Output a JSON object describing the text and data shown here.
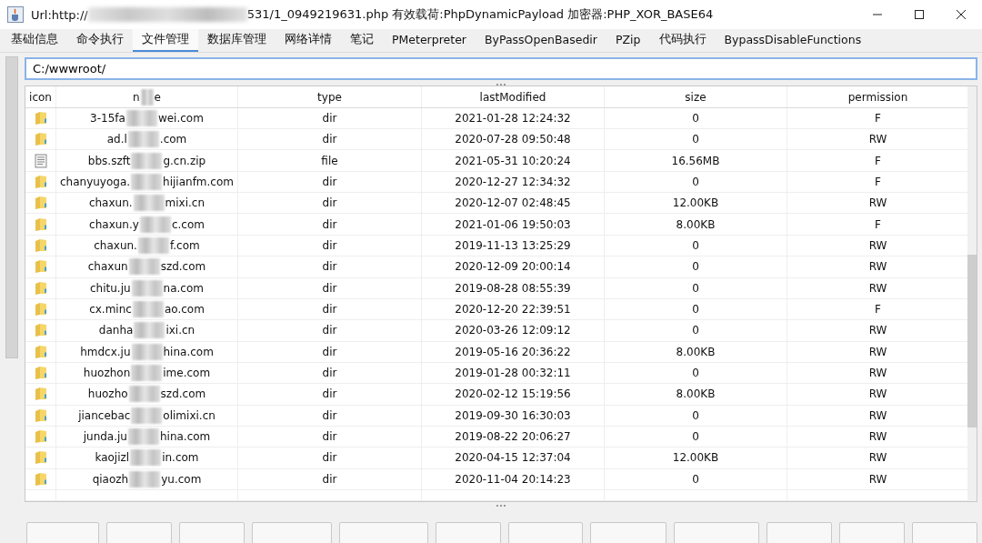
{
  "window": {
    "title_start": "Url:http://",
    "title_end": "531/1_0949219631.php 有效载荷:PhpDynamicPayload 加密器:PHP_XOR_BASE64"
  },
  "tabs": [
    {
      "label": "基础信息",
      "selected": false
    },
    {
      "label": "命令执行",
      "selected": false
    },
    {
      "label": "文件管理",
      "selected": true
    },
    {
      "label": "数据库管理",
      "selected": false
    },
    {
      "label": "网络详情",
      "selected": false
    },
    {
      "label": "笔记",
      "selected": false
    },
    {
      "label": "PMeterpreter",
      "selected": false
    },
    {
      "label": "ByPassOpenBasedir",
      "selected": false
    },
    {
      "label": "PZip",
      "selected": false
    },
    {
      "label": "代码执行",
      "selected": false
    },
    {
      "label": "BypassDisableFunctions",
      "selected": false
    }
  ],
  "path_field": {
    "value": "C:/wwwroot/"
  },
  "table": {
    "columns": [
      {
        "label": "icon"
      },
      {
        "label_start": "n",
        "label_end": "e"
      },
      {
        "label": "type"
      },
      {
        "label": "lastModified"
      },
      {
        "label": "size"
      },
      {
        "label": "permission"
      }
    ],
    "rows": [
      {
        "kind": "folder",
        "name_start": "3-15fa",
        "name_end": "wei.com",
        "type": "dir",
        "modified": "2021-01-28 12:24:32",
        "size": "0",
        "permission": "F"
      },
      {
        "kind": "folder",
        "name_start": "ad.l",
        "name_end": ".com",
        "type": "dir",
        "modified": "2020-07-28 09:50:48",
        "size": "0",
        "permission": "RW"
      },
      {
        "kind": "file",
        "name_start": "bbs.szft",
        "name_end": "g.cn.zip",
        "type": "file",
        "modified": "2021-05-31 10:20:24",
        "size": "16.56MB",
        "permission": "F"
      },
      {
        "kind": "folder",
        "name_start": "chanyuyoga.",
        "name_end": "hijianfm.com",
        "type": "dir",
        "modified": "2020-12-27 12:34:32",
        "size": "0",
        "permission": "F"
      },
      {
        "kind": "folder",
        "name_start": "chaxun.",
        "name_end": "mixi.cn",
        "type": "dir",
        "modified": "2020-12-07 02:48:45",
        "size": "12.00KB",
        "permission": "RW"
      },
      {
        "kind": "folder",
        "name_start": "chaxun.y",
        "name_end": "c.com",
        "type": "dir",
        "modified": "2021-01-06 19:50:03",
        "size": "8.00KB",
        "permission": "F"
      },
      {
        "kind": "folder",
        "name_start": "chaxun.",
        "name_end": "f.com",
        "type": "dir",
        "modified": "2019-11-13 13:25:29",
        "size": "0",
        "permission": "RW"
      },
      {
        "kind": "folder",
        "name_start": "chaxun",
        "name_end": "szd.com",
        "type": "dir",
        "modified": "2020-12-09 20:00:14",
        "size": "0",
        "permission": "RW"
      },
      {
        "kind": "folder",
        "name_start": "chitu.ju",
        "name_end": "na.com",
        "type": "dir",
        "modified": "2019-08-28 08:55:39",
        "size": "0",
        "permission": "RW"
      },
      {
        "kind": "folder",
        "name_start": "cx.minc",
        "name_end": "ao.com",
        "type": "dir",
        "modified": "2020-12-20 22:39:51",
        "size": "0",
        "permission": "F"
      },
      {
        "kind": "folder",
        "name_start": "danha",
        "name_end": "ixi.cn",
        "type": "dir",
        "modified": "2020-03-26 12:09:12",
        "size": "0",
        "permission": "RW"
      },
      {
        "kind": "folder",
        "name_start": "hmdcx.ju",
        "name_end": "hina.com",
        "type": "dir",
        "modified": "2019-05-16 20:36:22",
        "size": "8.00KB",
        "permission": "RW"
      },
      {
        "kind": "folder",
        "name_start": "huozhon",
        "name_end": "ime.com",
        "type": "dir",
        "modified": "2019-01-28 00:32:11",
        "size": "0",
        "permission": "RW"
      },
      {
        "kind": "folder",
        "name_start": "huozho",
        "name_end": "szd.com",
        "type": "dir",
        "modified": "2020-02-12 15:19:56",
        "size": "8.00KB",
        "permission": "RW"
      },
      {
        "kind": "folder",
        "name_start": "jiancebac",
        "name_end": "olimixi.cn",
        "type": "dir",
        "modified": "2019-09-30 16:30:03",
        "size": "0",
        "permission": "RW"
      },
      {
        "kind": "folder",
        "name_start": "junda.ju",
        "name_end": "hina.com",
        "type": "dir",
        "modified": "2019-08-22 20:06:27",
        "size": "0",
        "permission": "RW"
      },
      {
        "kind": "folder",
        "name_start": "kaojizl",
        "name_end": "in.com",
        "type": "dir",
        "modified": "2020-04-15 12:37:04",
        "size": "12.00KB",
        "permission": "RW"
      },
      {
        "kind": "folder",
        "name_start": "qiaozh",
        "name_end": "yu.com",
        "type": "dir",
        "modified": "2020-11-04 20:14:23",
        "size": "0",
        "permission": "RW"
      }
    ]
  }
}
